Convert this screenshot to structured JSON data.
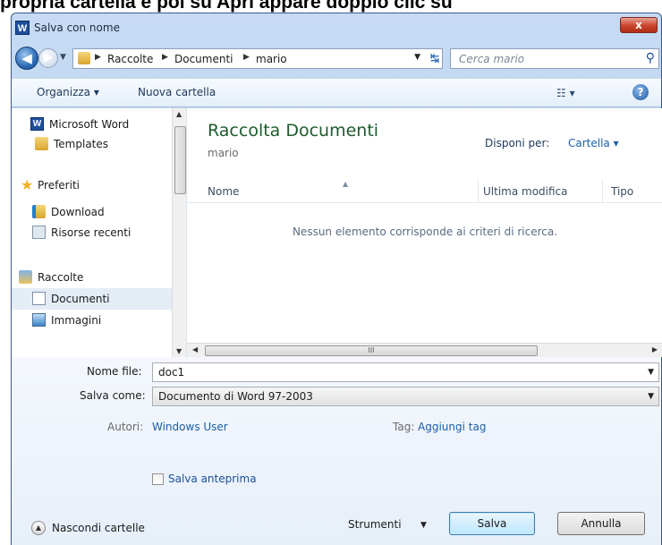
{
  "caption": {
    "text": "propria cartella e poi su Apri appare doppio clic su"
  },
  "window": {
    "title": "Salva con nome",
    "app_icon_text": "W",
    "close_label": "x"
  },
  "address": {
    "crumbs": [
      "Raccolte",
      "Documenti",
      "mario"
    ],
    "search_placeholder": "Cerca mario"
  },
  "toolbar": {
    "organize_label": "Organizza ▾",
    "new_folder_label": "Nuova cartella",
    "help_label": "?"
  },
  "sidebar": {
    "items": [
      {
        "label": "Microsoft Word",
        "icon": "word-icon"
      },
      {
        "label": "Templates",
        "icon": "folder-icon"
      },
      {
        "label": "Preferiti",
        "icon": "star-icon"
      },
      {
        "label": "Download",
        "icon": "download-folder-icon"
      },
      {
        "label": "Risorse recenti",
        "icon": "recent-places-icon"
      },
      {
        "label": "Raccolte",
        "icon": "libraries-icon"
      },
      {
        "label": "Documenti",
        "icon": "documents-icon"
      },
      {
        "label": "Immagini",
        "icon": "pictures-icon"
      }
    ],
    "selected": "Documenti"
  },
  "content": {
    "library_title": "Raccolta Documenti",
    "library_subtitle": "mario",
    "arrange_label": "Disponi per:",
    "arrange_value": "Cartella ▾",
    "columns": [
      "Nome",
      "Ultima modifica",
      "Tipo"
    ],
    "empty_message": "Nessun elemento corrisponde ai criteri di ricerca."
  },
  "scrollbar": {
    "thumb_grip": "III"
  },
  "form": {
    "filename_label": "Nome file:",
    "filename_value": "doc1",
    "savetype_label": "Salva come:",
    "savetype_value": "Documento di Word 97-2003",
    "authors_label": "Autori:",
    "authors_value": "Windows User",
    "tags_label": "Tag:",
    "tags_value": "Aggiungi tag",
    "thumbnail_label": "Salva anteprima",
    "thumbnail_checked": false
  },
  "footer": {
    "hide_folders_label": "Nascondi cartelle",
    "tools_label": "Strumenti",
    "save_label": "Salva",
    "cancel_label": "Annulla"
  },
  "colors": {
    "library_title": "#1e5b2e",
    "link": "#1a5fa8",
    "close_button": "#c9432b"
  }
}
